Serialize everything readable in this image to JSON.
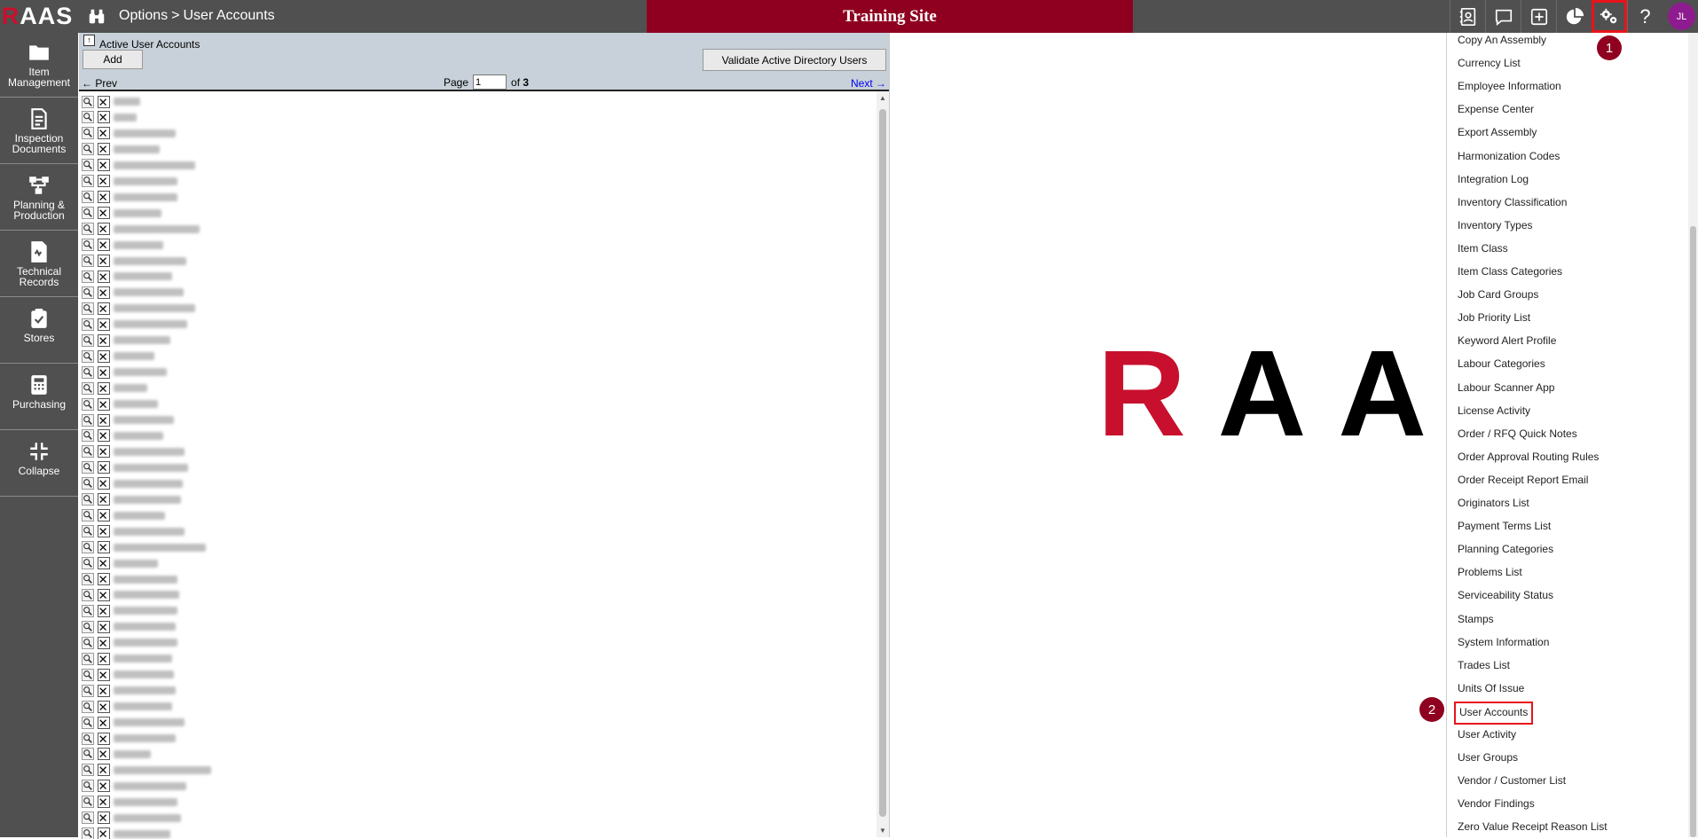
{
  "app": {
    "logo": "RAAS",
    "logo_first": "R",
    "logo_rest": "AAS"
  },
  "breadcrumb": {
    "section": "Options",
    "separator": ">",
    "page": "User Accounts"
  },
  "banner": "Training Site",
  "toolbar": {
    "icons": [
      "contacts-icon",
      "chat-icon",
      "add-icon",
      "reports-pie-icon",
      "settings-gears-icon",
      "help-icon"
    ],
    "help_label": "?",
    "avatar_initials": "JL"
  },
  "sidebar": {
    "items": [
      {
        "label1": "Item",
        "label2": "Management",
        "icon": "folder-icon"
      },
      {
        "label1": "Inspection",
        "label2": "Documents",
        "icon": "document-icon"
      },
      {
        "label1": "Planning &",
        "label2": "Production",
        "icon": "workflow-icon"
      },
      {
        "label1": "Technical",
        "label2": "Records",
        "icon": "records-icon"
      },
      {
        "label1": "Stores",
        "label2": "",
        "icon": "clipboard-check-icon"
      },
      {
        "label1": "Purchasing",
        "label2": "",
        "icon": "calculator-icon"
      },
      {
        "label1": "Collapse",
        "label2": "",
        "icon": "collapse-icon"
      }
    ]
  },
  "panel": {
    "title": "Active User Accounts",
    "add_label": "Add",
    "validate_label": "Validate Active Directory Users",
    "prev_label": "← Prev",
    "next_label": "Next →",
    "page_label": "Page",
    "page_value": "1",
    "of_label": "of",
    "total_pages": "3",
    "rows": [
      {
        "w": 30
      },
      {
        "w": 26
      },
      {
        "w": 70
      },
      {
        "w": 52
      },
      {
        "w": 92
      },
      {
        "w": 72
      },
      {
        "w": 72
      },
      {
        "w": 54
      },
      {
        "w": 97
      },
      {
        "w": 56
      },
      {
        "w": 82
      },
      {
        "w": 66
      },
      {
        "w": 79
      },
      {
        "w": 92
      },
      {
        "w": 83
      },
      {
        "w": 64
      },
      {
        "w": 46
      },
      {
        "w": 60
      },
      {
        "w": 38
      },
      {
        "w": 50
      },
      {
        "w": 68
      },
      {
        "w": 56
      },
      {
        "w": 80
      },
      {
        "w": 84
      },
      {
        "w": 78
      },
      {
        "w": 76
      },
      {
        "w": 58
      },
      {
        "w": 80
      },
      {
        "w": 104
      },
      {
        "w": 50
      },
      {
        "w": 72
      },
      {
        "w": 74
      },
      {
        "w": 72
      },
      {
        "w": 70
      },
      {
        "w": 72
      },
      {
        "w": 66
      },
      {
        "w": 68
      },
      {
        "w": 70
      },
      {
        "w": 66
      },
      {
        "w": 80
      },
      {
        "w": 70
      },
      {
        "w": 42
      },
      {
        "w": 110
      },
      {
        "w": 82
      },
      {
        "w": 72
      },
      {
        "w": 76
      },
      {
        "w": 64
      }
    ]
  },
  "watermark_logo": {
    "first": "R",
    "rest": "AAS"
  },
  "settings_menu": {
    "items": [
      "Copy An Assembly",
      "Currency List",
      "Employee Information",
      "Expense Center",
      "Export Assembly",
      "Harmonization Codes",
      "Integration Log",
      "Inventory Classification",
      "Inventory Types",
      "Item Class",
      "Item Class Categories",
      "Job Card Groups",
      "Job Priority List",
      "Keyword Alert Profile",
      "Labour Categories",
      "Labour Scanner App",
      "License Activity",
      "Order / RFQ Quick Notes",
      "Order Approval Routing Rules",
      "Order Receipt Report Email",
      "Originators List",
      "Payment Terms List",
      "Planning Categories",
      "Problems List",
      "Serviceability Status",
      "Stamps",
      "System Information",
      "Trades List",
      "Units Of Issue",
      "User Accounts",
      "User Activity",
      "User Groups",
      "Vendor / Customer List",
      "Vendor Findings",
      "Zero Value Receipt Reason List"
    ],
    "highlighted": "User Accounts"
  },
  "annotations": {
    "step1": "1",
    "step2": "2"
  },
  "colors": {
    "chrome": "#505050",
    "banner": "#8f0020",
    "highlight": "#e8141b",
    "avatar": "#8e1b8f"
  }
}
